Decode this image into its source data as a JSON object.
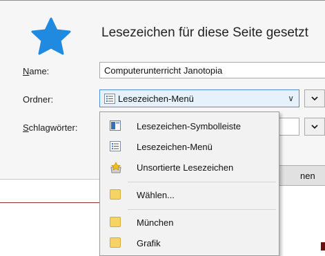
{
  "dialog": {
    "title": "Lesezeichen für diese Seite gesetzt",
    "name_label": "Name:",
    "name_value": "Computerunterricht Janotopia",
    "folder_label": "Ordner:",
    "folder_value": "Lesezeichen-Menü",
    "tags_label": "Schlagwörter:",
    "expand_folder_icon": "chevron-down-icon",
    "expand_tags_icon": "chevron-down-icon",
    "button_partial_label": "nen"
  },
  "folder_dropdown": {
    "items": [
      {
        "label": "Lesezeichen-Symbolleiste",
        "icon": "bookmarks-toolbar-icon"
      },
      {
        "label": "Lesezeichen-Menü",
        "icon": "bookmarks-menu-icon"
      },
      {
        "label": "Unsortierte Lesezeichen",
        "icon": "unsorted-bookmarks-icon"
      },
      {
        "label": "Wählen...",
        "icon": "folder-icon"
      },
      {
        "label": "München",
        "icon": "folder-icon"
      },
      {
        "label": "Grafik",
        "icon": "folder-icon"
      }
    ]
  },
  "colors": {
    "star": "#1f8ae0",
    "select_focus_border": "#4a90d9",
    "select_background": "#e5f1fb",
    "dropdown_background": "#f2f2f2"
  }
}
